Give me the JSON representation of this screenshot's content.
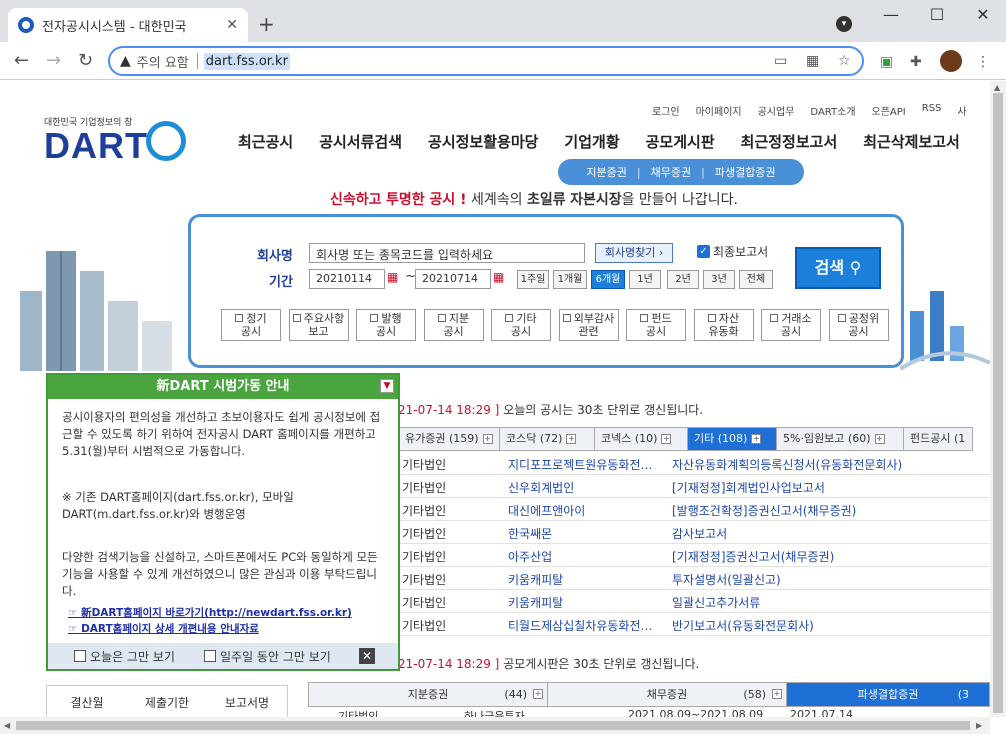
{
  "browser": {
    "tab_title": "전자공시시스템 - 대한민국",
    "tab_close": "✕",
    "new_tab": "+",
    "warning_text": "주의 요함",
    "url": "dart.fss.or.kr"
  },
  "header": {
    "logo_tag": "대한민국 기업정보의 창",
    "logo": "DART",
    "top_links": [
      "로그인",
      "마이페이지",
      "공시업무",
      "DART소개",
      "오픈API",
      "RSS",
      "사"
    ],
    "gnb": [
      "최근공시",
      "공시서류검색",
      "공시정보활용마당",
      "기업개황",
      "공모게시판",
      "최근정정보고서",
      "최근삭제보고서"
    ],
    "subtabs": [
      "지분증권",
      "채무증권",
      "파생결합증권"
    ],
    "slogan_red1": "신속하고",
    "slogan_red2": "투명한 공시 !",
    "slogan_mid": "세계속의",
    "slogan_b1": "초일류",
    "slogan_b2": "자본시장",
    "slogan_end": "을 만들어 나갑니다."
  },
  "search": {
    "corp_label": "회사명",
    "period_label": "기간",
    "corp_placeholder": "회사명 또는 종목코드를 입력하세요",
    "corp_find_btn": "회사명찾기 ›",
    "final_report_label": "최종보고서",
    "final_report_check": "✓",
    "search_btn": "검색",
    "date_from": "20210114",
    "date_to": "20210714",
    "tilde": "~",
    "periods": [
      "1주일",
      "1개월",
      "6개월",
      "1년",
      "2년",
      "3년",
      "전체"
    ],
    "categories": [
      [
        "정기",
        "공시"
      ],
      [
        "주요사항",
        "보고"
      ],
      [
        "발행",
        "공시"
      ],
      [
        "지분",
        "공시"
      ],
      [
        "기타",
        "공시"
      ],
      [
        "외부감사",
        "관련"
      ],
      [
        "펀드",
        "공시"
      ],
      [
        "자산",
        "유동화"
      ],
      [
        "거래소",
        "공시"
      ],
      [
        "공정위",
        "공시"
      ]
    ]
  },
  "notice": {
    "date1": "21-07-14 18:29 ]",
    "text1": "오늘의 공시는 30초 단위로 갱신됩니다.",
    "date2": "21-07-14 18:29 ]",
    "text2": "공모게시판은 30초 단위로 갱신됩니다."
  },
  "market_tabs": [
    {
      "name": "유가증권",
      "count": "(159)"
    },
    {
      "name": "코스닥",
      "count": "(72)"
    },
    {
      "name": "코넥스",
      "count": "(10)"
    },
    {
      "name": "기타",
      "count": "(108)"
    },
    {
      "name": "5%·임원보고",
      "count": "(60)"
    },
    {
      "name": "펀드공시",
      "count": "(1"
    }
  ],
  "rows": [
    [
      "기타법인",
      "지디포프로젝트원유동화전…",
      "자산유동화계획의등록신청서(유동화전문회사)"
    ],
    [
      "기타법인",
      "신우회계법인",
      "[기재정정]회계법인사업보고서"
    ],
    [
      "기타법인",
      "대신에프앤아이",
      "[발행조건확정]증권신고서(채무증권)"
    ],
    [
      "기타법인",
      "한국쌔몬",
      "감사보고서"
    ],
    [
      "기타법인",
      "아주산업",
      "[기재정정]증권신고서(채무증권)"
    ],
    [
      "기타법인",
      "키움캐피탈",
      "투자설명서(일괄신고)"
    ],
    [
      "기타법인",
      "키움캐피탈",
      "일괄신고추가서류"
    ],
    [
      "기타법인",
      "티월드제삼십칠차유동화전…",
      "반기보고서(유동화전문회사)"
    ]
  ],
  "popup": {
    "title": "新DART 시범가동 안내",
    "dd": "▼",
    "p1": "공시이용자의 편의성을 개선하고 초보이용자도 쉽게 공시정보에 접근할 수 있도록 하기 위하여 전자공시 DART 홈페이지를 개편하고 5.31(월)부터 시범적으로 가동합니다.",
    "p2": "※ 기존 DART홈페이지(dart.fss.or.kr), 모바일 DART(m.dart.fss.or.kr)와 병행운영",
    "p3": "다양한 검색기능을 신설하고, 스마트폰에서도 PC와 동일하게 모든 기능을 사용할 수 있게 개선하였으니 많은 관심과 이용 부탁드립니다.",
    "link1": "☞ 新DART홈페이지 바로가기(http://newdart.fss.or.kr)",
    "link2": "☞ DART홈페이지 상세 개편내용 안내자료",
    "opt1": "오늘은 그만 보기",
    "opt2": "일주일 동안 그만 보기",
    "close": "✕"
  },
  "bottom_left_headers": [
    "결산월",
    "제출기한",
    "보고서명"
  ],
  "bottom_tabs": [
    {
      "name": "지분증권",
      "count": "(44)"
    },
    {
      "name": "채무증권",
      "count": "(58)"
    },
    {
      "name": "파생결합증권",
      "count": "(3"
    }
  ],
  "bottom_row": [
    "기타법인",
    "하나금융투자",
    "2021.08.09~2021.08.09",
    "2021.07.14"
  ],
  "colors": {
    "accent": "#1e6fd6",
    "brand": "#1f3e9a",
    "popup_green": "#4aa53e",
    "alert_red": "#c8102e"
  }
}
